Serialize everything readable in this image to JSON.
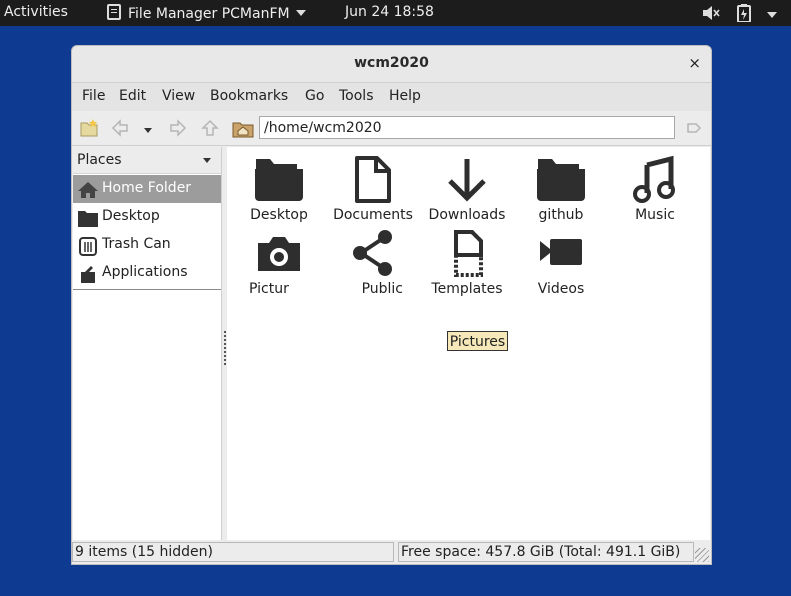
{
  "topbar": {
    "activities": "Activities",
    "app_name": "File Manager PCManFM",
    "clock": "Jun 24  18:58"
  },
  "window": {
    "title": "wcm2020",
    "close": "×",
    "menus": [
      "File",
      "Edit",
      "View",
      "Bookmarks",
      "Go",
      "Tools",
      "Help"
    ],
    "address": "/home/wcm2020"
  },
  "side": {
    "header": "Places",
    "items": [
      {
        "label": "Home Folder",
        "icon": "home-icon",
        "selected": true
      },
      {
        "label": "Desktop",
        "icon": "folder-icon"
      },
      {
        "label": "Trash Can",
        "icon": "trash-icon"
      },
      {
        "label": "Applications",
        "icon": "applications-icon"
      }
    ]
  },
  "files": [
    {
      "name": "Desktop",
      "icon": "folder-icon"
    },
    {
      "name": "Documents",
      "icon": "document-icon"
    },
    {
      "name": "Downloads",
      "icon": "download-icon"
    },
    {
      "name": "github",
      "icon": "folder-icon"
    },
    {
      "name": "Music",
      "icon": "music-icon"
    },
    {
      "name": "Pictur",
      "icon": "camera-icon"
    },
    {
      "name": "Public",
      "icon": "share-icon"
    },
    {
      "name": "Templates",
      "icon": "template-icon"
    },
    {
      "name": "Videos",
      "icon": "video-icon"
    }
  ],
  "rename_value": "Pictures",
  "status": {
    "left": "9 items (15 hidden)",
    "right": "Free space: 457.8 GiB (Total: 491.1 GiB)"
  },
  "colors": {
    "desktop": "#0f3a91",
    "topbar": "#1c1c1c",
    "selection": "#9c9c9c",
    "rename_bg": "#f6e8b8"
  }
}
